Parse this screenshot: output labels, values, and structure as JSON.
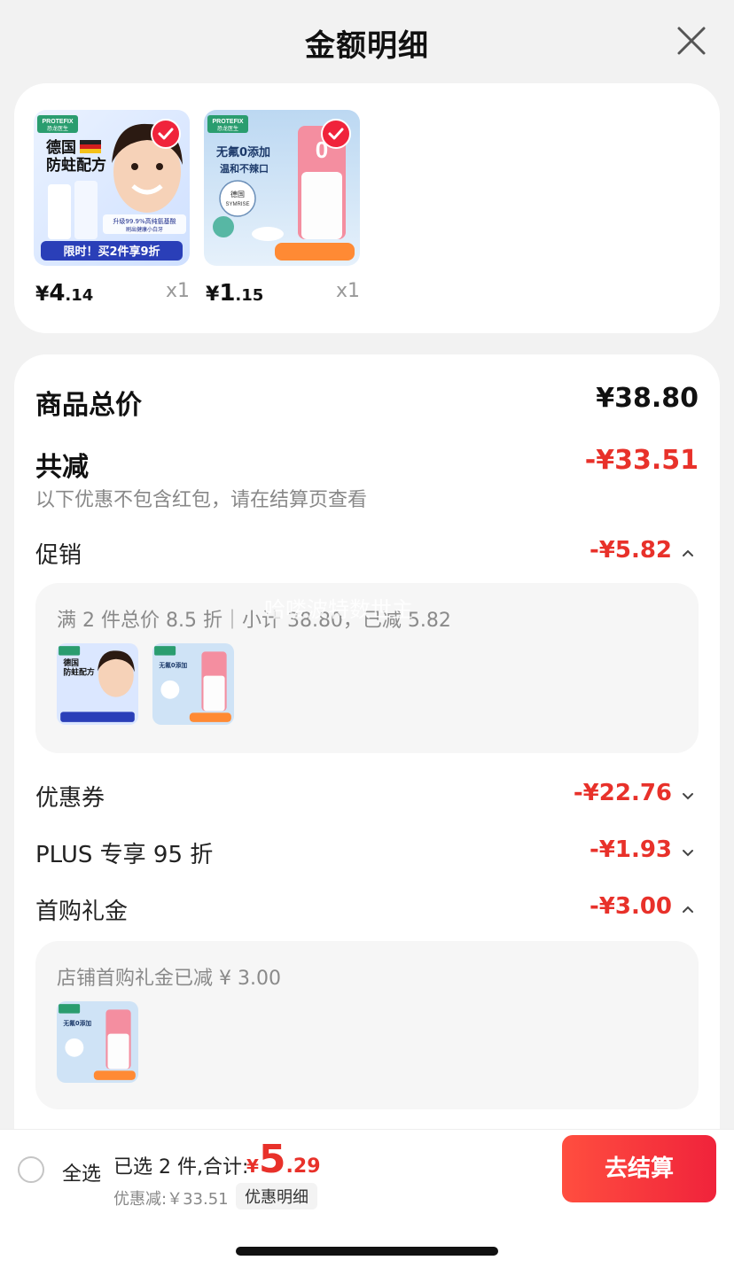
{
  "header": {
    "title": "金额明细"
  },
  "products": [
    {
      "price_yen": "¥",
      "price_int": "4",
      "price_dec": ".14",
      "qty": "x1",
      "image_text": {
        "brand": "PROTEFIX",
        "brand_cn": "恐龙医生",
        "line1": "德国",
        "line2": "防蛀配方",
        "tag": "升级99.9%高纯氨基酸",
        "tag2": "刷出健康小白牙",
        "banner": "限时！买2件享9折"
      }
    },
    {
      "price_yen": "¥",
      "price_int": "1",
      "price_dec": ".15",
      "qty": "x1",
      "image_text": {
        "brand": "PROTEFIX",
        "brand_cn": "恐龙医生",
        "line1": "无氟0添加",
        "line2": "温和不辣口",
        "badge1": "德国",
        "badge2": "SYMRISE"
      }
    }
  ],
  "breakdown": {
    "goods_total_label": "商品总价",
    "goods_total_value": "¥38.80",
    "total_cut_label": "共减",
    "total_cut_value": "-¥33.51",
    "note": "以下优惠不包含红包，请在结算页查看",
    "promo_label": "促销",
    "promo_value": "-¥5.82",
    "promo_detail": "满 2 件总价 8.5 折｜小计 38.80，已减 5.82",
    "coupon_label": "优惠券",
    "coupon_value": "-¥22.76",
    "plus_label": "PLUS 专享 95 折",
    "plus_value": "-¥1.93",
    "first_gift_label": "首购礼金",
    "first_gift_value": "-¥3.00",
    "first_gift_detail": "店铺首购礼金已减 ¥ 3.00"
  },
  "watermark": "哈喽波特数世主",
  "bottom_bar": {
    "select_all": "全选",
    "summary_prefix": "已选 2 件,合计:",
    "total_yen": "¥",
    "total_int": "5",
    "total_dec": ".29",
    "discount_line": "优惠减:￥33.51",
    "detail_chip": "优惠明细",
    "checkout": "去结算"
  },
  "colors": {
    "accent_red": "#e8312a",
    "button_red": "#f0233b",
    "background": "#f2f2f2"
  }
}
